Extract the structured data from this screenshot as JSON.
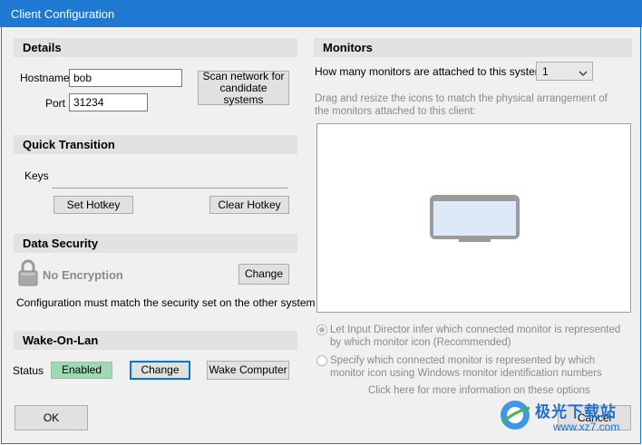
{
  "window": {
    "title": "Client Configuration"
  },
  "details": {
    "header": "Details",
    "hostname_label": "Hostname",
    "hostname_value": "bob",
    "port_label": "Port",
    "port_value": "31234",
    "scan_button": "Scan network for candidate systems"
  },
  "quick_transition": {
    "header": "Quick Transition",
    "keys_label": "Keys",
    "set_hotkey": "Set Hotkey",
    "clear_hotkey": "Clear Hotkey"
  },
  "data_security": {
    "header": "Data Security",
    "status": "No Encryption",
    "change_button": "Change",
    "note": "Configuration must match the security set on the other system"
  },
  "wake_on_lan": {
    "header": "Wake-On-Lan",
    "status_label": "Status",
    "status_value": "Enabled",
    "change_button": "Change",
    "wake_button": "Wake Computer"
  },
  "monitors": {
    "header": "Monitors",
    "count_label": "How many monitors are attached to this system",
    "count_value": "1",
    "instructions": "Drag and resize the icons to match the physical arrangement of the monitors attached to this client:",
    "option1": "Let Input Director infer which connected monitor is represented by which monitor icon (Recommended)",
    "option2": "Specify which connected monitor is represented by which monitor icon using Windows monitor identification numbers",
    "more_info": "Click here for more information on these options"
  },
  "footer": {
    "ok": "OK",
    "cancel": "Cancel"
  },
  "watermark": {
    "text": "极光下载站",
    "url": "www.xz7.com"
  },
  "colors": {
    "title_bar": "#1f78d1",
    "enabled_badge": "#9fd9b4",
    "focus": "#0078d7"
  }
}
